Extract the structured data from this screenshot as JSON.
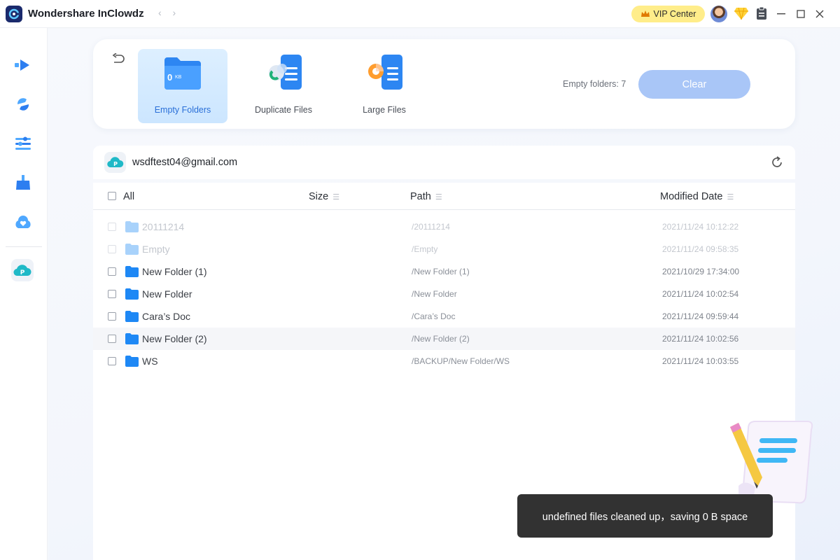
{
  "app": {
    "title": "Wondershare InClowdz",
    "nav_arrows": "‹ ›"
  },
  "header": {
    "vip_label": "VIP Center"
  },
  "tools": [
    {
      "label": "Empty Folders",
      "badge": "0",
      "badge_unit": "KB",
      "active": true
    },
    {
      "label": "Duplicate Files",
      "active": false
    },
    {
      "label": "Large Files",
      "active": false
    }
  ],
  "summary": {
    "empty_count": "Empty folders: 7",
    "clear_label": "Clear"
  },
  "account": {
    "email": "wsdftest04@gmail.com"
  },
  "table": {
    "columns": {
      "all": "All",
      "size": "Size",
      "path": "Path",
      "date": "Modified Date"
    },
    "rows": [
      {
        "name": "20111214",
        "path": "/20111214",
        "date": "2021/11/24 10:12:22",
        "disabled": true
      },
      {
        "name": "Empty",
        "path": "/Empty",
        "date": "2021/11/24 09:58:35",
        "disabled": true
      },
      {
        "name": "New Folder (1)",
        "path": "/New Folder (1)",
        "date": "2021/10/29 17:34:00",
        "disabled": false
      },
      {
        "name": "New Folder",
        "path": "/New Folder",
        "date": "2021/11/24 10:02:54",
        "disabled": false
      },
      {
        "name": "Cara’s Doc",
        "path": "/Cara’s Doc",
        "date": "2021/11/24 09:59:44",
        "disabled": false
      },
      {
        "name": "New Folder (2)",
        "path": "/New Folder (2)",
        "date": "2021/11/24 10:02:56",
        "disabled": false
      },
      {
        "name": "WS",
        "path": "/BACKUP/New Folder/WS",
        "date": "2021/11/24 10:03:55",
        "disabled": false
      }
    ]
  },
  "toast": {
    "message": "undefined files cleaned up，saving 0 B space"
  },
  "colors": {
    "accent": "#2a6fd8",
    "folder": "#1e88f5",
    "clear_button": "#a9c6f7",
    "vip": "#ffed8a",
    "toast": "#323232"
  }
}
